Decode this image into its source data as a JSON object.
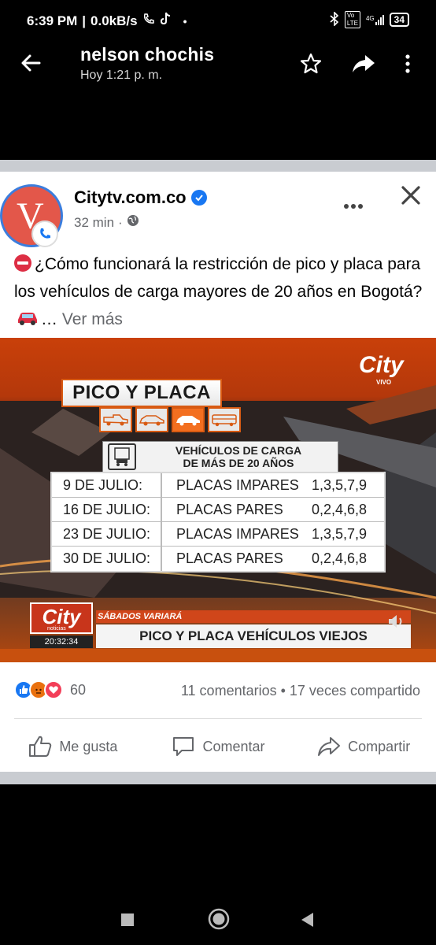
{
  "status_bar": {
    "time": "6:39 PM",
    "speed": "0.0kB/s",
    "network": "4G",
    "battery": "34"
  },
  "header": {
    "title": "nelson chochis",
    "subtitle": "Hoy 1:21 p. m."
  },
  "post": {
    "page_name": "Citytv.com.co",
    "time": "32 min",
    "text": "¿Cómo funcionará la restricción de pico y placa para los vehículos de carga mayores de 20 años en Bogotá?",
    "ellipsis": "…",
    "see_more": "Ver más",
    "avatar_letter": "V"
  },
  "news_image": {
    "logo": "City",
    "logo_sub": "VIVO",
    "title": "PICO Y PLACA",
    "cargo_heading_line1": "VEHÍCULOS DE CARGA",
    "cargo_heading_line2": "DE MÁS DE 20 AÑOS",
    "schedule": [
      {
        "date": "9 DE JULIO:",
        "plates": "PLACAS IMPARES",
        "numbers": "1,3,5,7,9"
      },
      {
        "date": "16 DE JULIO:",
        "plates": "PLACAS PARES",
        "numbers": "0,2,4,6,8"
      },
      {
        "date": "23 DE JULIO:",
        "plates": "PLACAS IMPARES",
        "numbers": "1,3,5,7,9"
      },
      {
        "date": "30 DE JULIO:",
        "plates": "PLACAS PARES",
        "numbers": "0,2,4,6,8"
      }
    ],
    "lower_logo": "City",
    "lower_logo_sub": "noticias",
    "lower_time": "20:32:34",
    "lower_sub": "SÁBADOS VARIARÁ",
    "lower_main": "PICO Y PLACA VEHÍCULOS VIEJOS"
  },
  "engagement": {
    "reaction_count": "60",
    "stats": "11 comentarios • 17 veces compartido"
  },
  "actions": {
    "like": "Me gusta",
    "comment": "Comentar",
    "share": "Compartir"
  },
  "colors": {
    "facebook_blue": "#1877f2",
    "avatar_red": "#e3574a",
    "city_orange": "#f36f20"
  }
}
